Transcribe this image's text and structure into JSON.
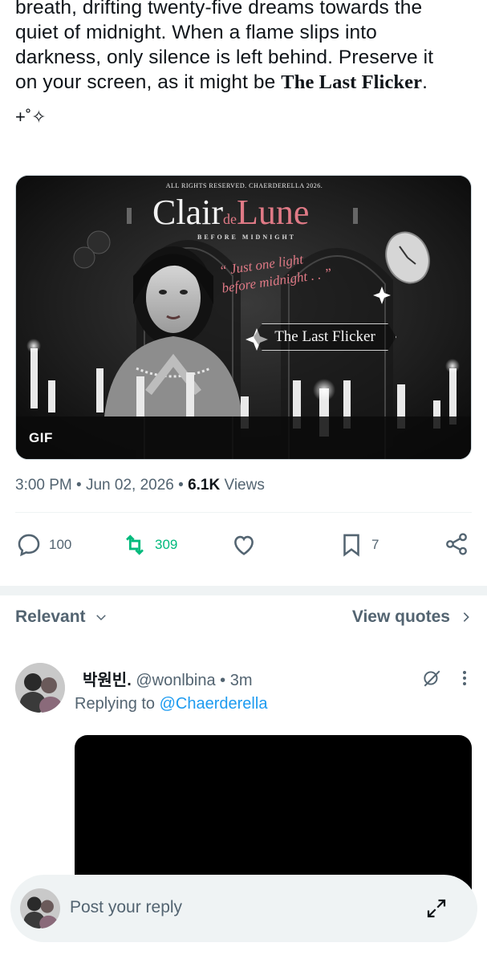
{
  "tweet": {
    "text_line1": "breath, drifting twenty-five dreams towards the",
    "text_line2": "quiet of midnight. When a flame slips into",
    "text_line3": "darkness, only silence is left behind. Preserve it",
    "text_line4_prefix": "on your screen, as it might be ",
    "text_line4_bold": "The Last Flicker",
    "text_line4_suffix": ".",
    "sparkles": "+˚✧"
  },
  "media": {
    "copyright": "ALL RIGHTS RESERVED. CHAERDERELLA 2026.",
    "title_main": "Clair",
    "title_de": "de",
    "title_lune": "Lune",
    "subtitle": "BEFORE MIDNIGHT",
    "quote_line1": "“ Just one light",
    "quote_line2": "before midnight . . ”",
    "flicker_label": "The Last Flicker",
    "gif_badge": "GIF"
  },
  "meta": {
    "time": "3:00 PM",
    "date": "Jun 02, 2026",
    "views_count": "6.1K",
    "views_label": "Views"
  },
  "actions": {
    "replies": "100",
    "reposts": "309",
    "bookmarks": "7"
  },
  "sort": {
    "label": "Relevant",
    "view_quotes": "View quotes"
  },
  "reply": {
    "name": "박원빈.",
    "handle": "@wonlbina",
    "time": "3m",
    "replying_prefix": "Replying to ",
    "replying_to": "@Chaerderella"
  },
  "composer": {
    "placeholder": "Post your reply"
  },
  "colors": {
    "accent": "#1d9bf0",
    "repost_green": "#00ba7c",
    "secondary_text": "#536471"
  }
}
